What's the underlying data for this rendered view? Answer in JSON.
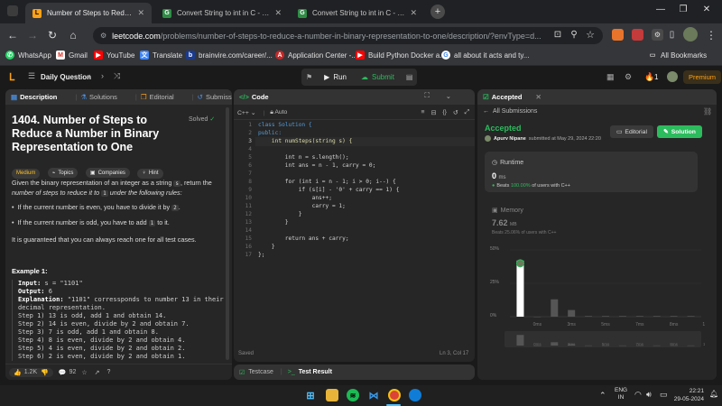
{
  "colors": {
    "leetcode_orange": "#ffa116",
    "accepted_green": "#2cbb5d",
    "easy_green": "#2db55d",
    "medium_yellow": "#ffc01e",
    "chrome_bg": "#202124",
    "panel_bg": "#262626"
  },
  "browser": {
    "tabs": [
      {
        "title": "Number of Steps to Reduce a Nu",
        "icon": "leetcode-icon",
        "active": true
      },
      {
        "title": "Convert String to int in C - Geeks",
        "icon": "geeksforgeeks-icon",
        "active": false
      },
      {
        "title": "Convert String to int in C - Geeks",
        "icon": "geeksforgeeks-icon",
        "active": false
      }
    ],
    "new_tab": "+",
    "url_host": "leetcode.com",
    "url_path": "/problems/number-of-steps-to-reduce-a-number-in-binary-representation-to-one/description/?envType=d...",
    "bookmarks": [
      {
        "label": "WhatsApp",
        "icon": "whatsapp-icon"
      },
      {
        "label": "Gmail",
        "icon": "gmail-icon"
      },
      {
        "label": "YouTube",
        "icon": "youtube-icon"
      },
      {
        "label": "Translate",
        "icon": "translate-icon"
      },
      {
        "label": "brainvire.com/career/...",
        "icon": "brainvire-icon"
      },
      {
        "label": "Application Center -...",
        "icon": "application-center-icon"
      },
      {
        "label": "Build Python Docker a...",
        "icon": "youtube-icon"
      },
      {
        "label": "all about it acts and ty...",
        "icon": "google-icon"
      }
    ],
    "all_bookmarks": "All Bookmarks"
  },
  "lc_header": {
    "daily_question": "Daily Question",
    "run": "Run",
    "submit": "Submit",
    "streak": "1",
    "premium": "Premium"
  },
  "description": {
    "tabs": [
      "Description",
      "Solutions",
      "Editorial",
      "Submissions"
    ],
    "title": "1404. Number of Steps to Reduce a Number in Binary Representation to One",
    "solved": "Solved",
    "difficulty": "Medium",
    "chips": [
      "Topics",
      "Companies",
      "Hint"
    ],
    "para1_a": "Given the binary representation of an integer as a string ",
    "para1_s": "s",
    "para1_b": ", return the ",
    "para1_c": "number of steps to reduce it to ",
    "para1_1": "1",
    "para1_d": " under the following rules:",
    "bullet1_a": "If the current number is even, you have to divide it by ",
    "bullet1_code": "2",
    "bullet1_b": ".",
    "bullet2_a": "If the current number is odd, you have to add ",
    "bullet2_code": "1",
    "bullet2_b": " to it.",
    "para2": "It is guaranteed that you can always reach one for all test cases.",
    "example_title": "Example 1:",
    "ex_input_label": "Input:",
    "ex_input": " s = \"1101\"",
    "ex_output_label": "Output:",
    "ex_output": " 6",
    "ex_expl_label": "Explanation:",
    "ex_expl": " \"1101\" corressponds to number 13 in their",
    "ex_expl2": "decimal representation.",
    "steps": [
      "Step 1) 13 is odd, add 1 and obtain 14.",
      "Step 2) 14 is even, divide by 2 and obtain 7.",
      "Step 3) 7 is odd, add 1 and obtain 8.",
      "Step 4) 8 is even, divide by 2 and obtain 4.",
      "Step 5) 4 is even, divide by 2 and obtain 2.",
      "Step 6) 2 is even, divide by 2 and obtain 1."
    ],
    "likes": "1.2K",
    "comments": "92"
  },
  "editor": {
    "title": "Code",
    "language": "C++",
    "auto": "Auto",
    "lines": [
      "class Solution {",
      "public:",
      "    int numSteps(string s) {",
      "",
      "        int n = s.length();",
      "        int ans = n - 1, carry = 0;",
      "",
      "        for (int i = n - 1; i > 0; i--) {",
      "            if (s[i] - '0' + carry == 1) {",
      "                ans++;",
      "                carry = 1;",
      "            }",
      "        }",
      "",
      "        return ans + carry;",
      "    }",
      "};"
    ],
    "line_numbers": [
      "1",
      "2",
      "3",
      "4",
      "5",
      "6",
      "7",
      "8",
      "9",
      "10",
      "11",
      "12",
      "13",
      "14",
      "15",
      "16",
      "17"
    ],
    "saved": "Saved",
    "cursor": "Ln 3, Col 17",
    "bottom_tabs": [
      "Testcase",
      "Test Result"
    ]
  },
  "result": {
    "tab": "Accepted",
    "all_submissions": "All Submissions",
    "status": "Accepted",
    "user": "Apurv Nipane",
    "submitted": "submitted at May 29, 2024 22:20",
    "editorial": "Editorial",
    "solution": "Solution",
    "runtime_label": "Runtime",
    "runtime_value": "0",
    "runtime_unit": "ms",
    "beats_label": "Beats",
    "beats_value": "100.00%",
    "beats_suffix": "of users with C++",
    "memory_label": "Memory",
    "memory_value": "7.62",
    "memory_unit": "MB",
    "memory_beats": "Beats 25.06% of users with C++"
  },
  "chart_data": {
    "type": "bar",
    "categories": [
      "0ms",
      "3ms",
      "5ms",
      "7ms",
      "8ms",
      "12ms"
    ],
    "y_ticks": [
      "50%",
      "25%",
      "0%"
    ],
    "ylim": [
      0,
      50
    ],
    "values": [
      42,
      0,
      13,
      5,
      0.5,
      0.5,
      0.5,
      0.5,
      0.5,
      0.5,
      0.5
    ],
    "highlight_index": 0,
    "highlight_color": "#ffffff",
    "bar_color": "#555555"
  },
  "taskbar": {
    "lang": "ENG",
    "region": "IN",
    "time": "22:21",
    "date": "29-05-2024"
  }
}
